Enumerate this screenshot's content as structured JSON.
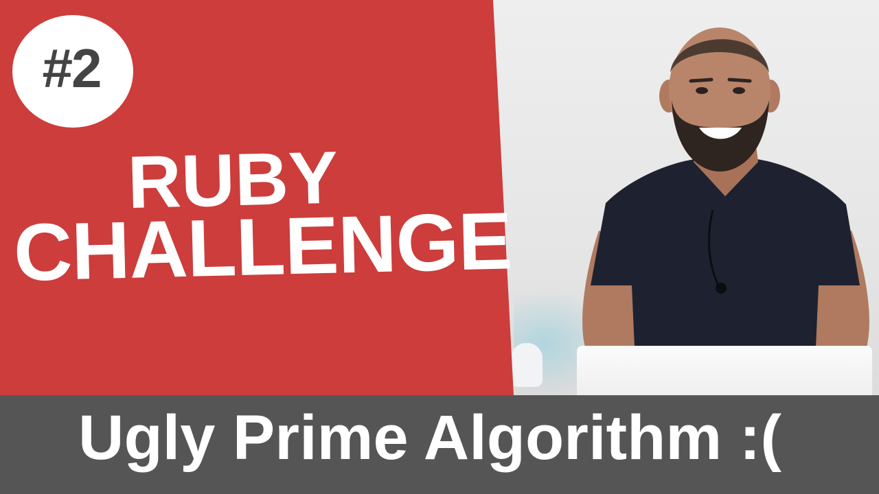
{
  "badge": {
    "text": "#2"
  },
  "title": {
    "line1": "RUBY",
    "line2": "CHALLENGE"
  },
  "caption": {
    "text": "Ugly Prime Algorithm :("
  },
  "colors": {
    "red_panel": "#cc3d3b",
    "bottom_bar": "#555555",
    "badge_bg": "#ffffff",
    "badge_text": "#444444",
    "title_text": "#ffffff",
    "shirt": "#1e2230",
    "skin": "#b9856a",
    "beard": "#2e2420"
  }
}
